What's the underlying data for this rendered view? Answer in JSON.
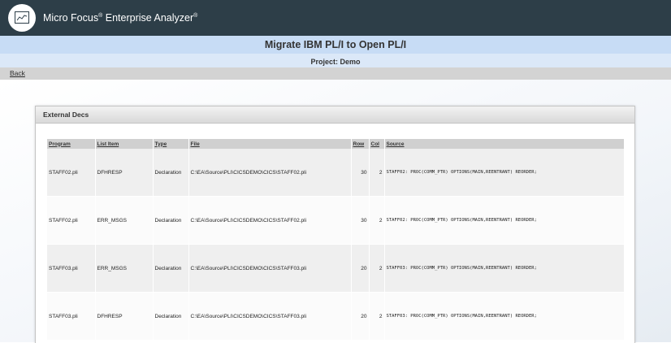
{
  "header": {
    "brand_name": "Micro Focus",
    "brand_mark": "®",
    "product_name": "Enterprise Analyzer",
    "product_mark": "®",
    "logo_icon": "chart-line-icon"
  },
  "page": {
    "title": "Migrate IBM PL/I to Open PL/I",
    "project_label": "Project: Demo",
    "back_link": "Back"
  },
  "panel": {
    "title": "External Decs",
    "columns": [
      "Program",
      "List Item",
      "Type",
      "File",
      "Row",
      "Col",
      "Source"
    ],
    "rows": [
      [
        "STAFF02.pli",
        "DFHRESP",
        "Declaration",
        "C:\\EA\\Source\\PLI\\CICSDEMO\\CICS\\STAFF02.pli",
        "30",
        "2",
        "STAFF02: PROC(COMM_PTR) OPTIONS(MAIN,REENTRANT) REORDER;"
      ],
      [
        "STAFF02.pli",
        "ERR_MSGS",
        "Declaration",
        "C:\\EA\\Source\\PLI\\CICSDEMO\\CICS\\STAFF02.pli",
        "30",
        "2",
        "STAFF02: PROC(COMM_PTR) OPTIONS(MAIN,REENTRANT) REORDER;"
      ],
      [
        "STAFF03.pli",
        "ERR_MSGS",
        "Declaration",
        "C:\\EA\\Source\\PLI\\CICSDEMO\\CICS\\STAFF03.pli",
        "20",
        "2",
        "STAFF03: PROC(COMM_PTR) OPTIONS(MAIN,REENTRANT) REORDER;"
      ],
      [
        "STAFF03.pli",
        "DFHRESP",
        "Declaration",
        "C:\\EA\\Source\\PLI\\CICSDEMO\\CICS\\STAFF03.pli",
        "20",
        "2",
        "STAFF03: PROC(COMM_PTR) OPTIONS(MAIN,REENTRANT) REORDER;"
      ]
    ]
  },
  "colors": {
    "topbar": "#2d3e48",
    "title_band": "#c7dcf5",
    "project_band": "#dbe8f8",
    "back_band": "#d3d3d3"
  }
}
